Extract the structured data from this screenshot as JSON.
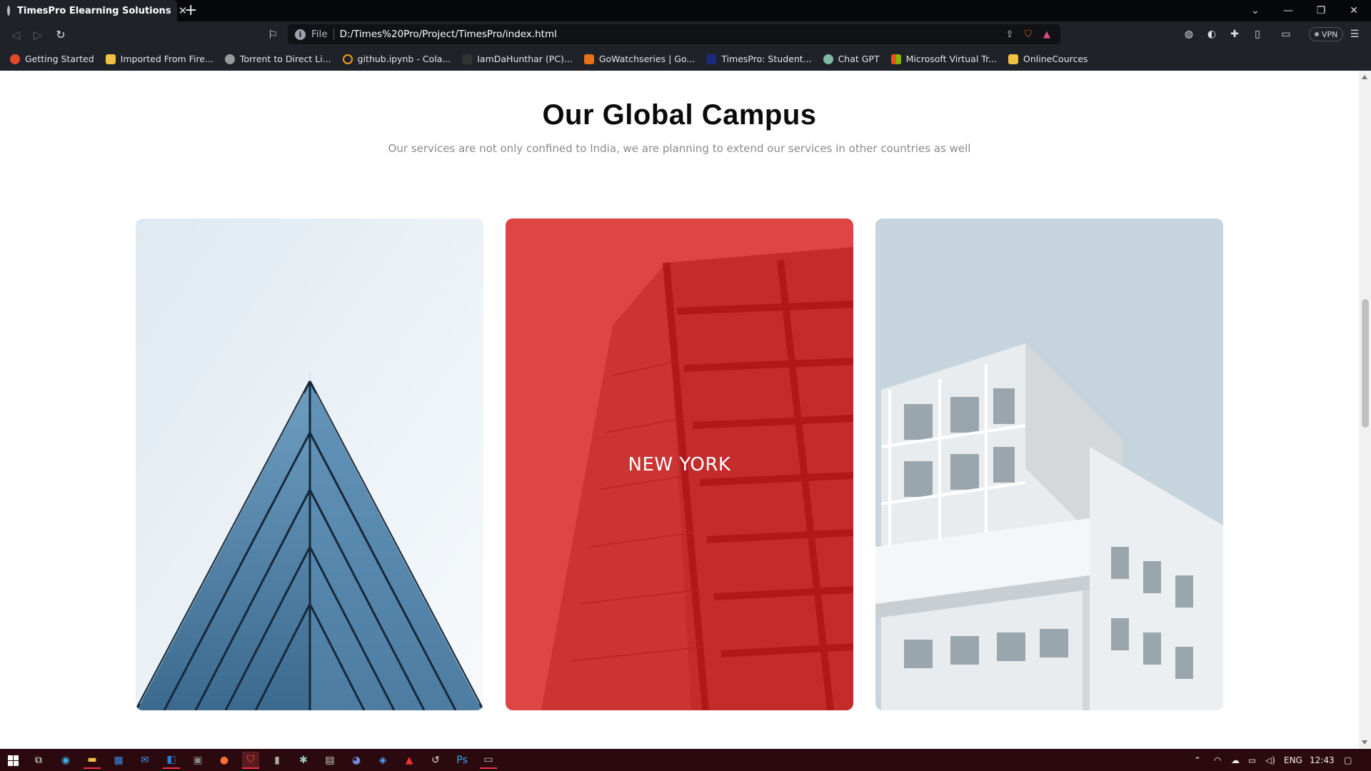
{
  "browser": {
    "tab_title": "TimesPro Elearning Solutions",
    "url_scheme": "File",
    "url": "D:/Times%20Pro/Project/TimesPro/index.html",
    "vpn_label": "VPN"
  },
  "bookmarks": [
    {
      "label": "Getting Started",
      "icon": "firefox-icon"
    },
    {
      "label": "Imported From Fire...",
      "icon": "folder-icon"
    },
    {
      "label": "Torrent to Direct Li...",
      "icon": "globe-icon"
    },
    {
      "label": "github.ipynb - Cola...",
      "icon": "colab-icon"
    },
    {
      "label": "IamDaHunthar (PC)...",
      "icon": "app-icon"
    },
    {
      "label": "GoWatchseries | Go...",
      "icon": "app-icon"
    },
    {
      "label": "TimesPro: Student...",
      "icon": "timespro-icon"
    },
    {
      "label": "Chat GPT",
      "icon": "chatgpt-icon"
    },
    {
      "label": "Microsoft Virtual Tr...",
      "icon": "microsoft-icon"
    },
    {
      "label": "OnlineCources",
      "icon": "folder-icon"
    }
  ],
  "page": {
    "title": "Our Global Campus",
    "subtitle": "Our services are not only confined to India, we are planning to extend our services in other countries as well",
    "cards": [
      {
        "label": ""
      },
      {
        "label": "NEW YORK"
      },
      {
        "label": ""
      }
    ]
  },
  "taskbar": {
    "language": "ENG",
    "time": "12:43"
  },
  "colors": {
    "accent_red": "#e61414",
    "taskbar": "#2b0a0f"
  }
}
